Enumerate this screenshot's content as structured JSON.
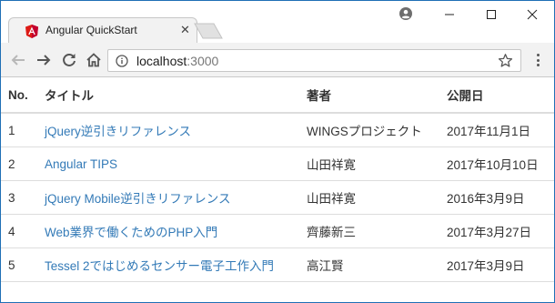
{
  "browser": {
    "tab_title": "Angular QuickStart",
    "tab_close_glyph": "✕",
    "url_host": "localhost",
    "url_port": ":3000",
    "icons": {
      "favicon": "angular-shield-icon",
      "profile": "profile-icon",
      "minimize": "minimize-icon",
      "maximize": "maximize-icon",
      "close": "close-icon",
      "back": "back-arrow-icon",
      "forward": "forward-arrow-icon",
      "reload": "reload-icon",
      "home": "home-icon",
      "info": "info-icon",
      "bookmark": "star-icon",
      "menu": "kebab-menu-icon"
    },
    "colors": {
      "accent_border": "#1f6fb5",
      "favicon_red": "#dd1b16",
      "link": "#337ab7"
    }
  },
  "table": {
    "headers": [
      "No.",
      "タイトル",
      "著者",
      "公開日"
    ],
    "rows": [
      {
        "no": "1",
        "title": "jQuery逆引きリファレンス",
        "author": "WINGSプロジェクト",
        "date": "2017年11月1日"
      },
      {
        "no": "2",
        "title": "Angular TIPS",
        "author": "山田祥寛",
        "date": "2017年10月10日"
      },
      {
        "no": "3",
        "title": "jQuery Mobile逆引きリファレンス",
        "author": "山田祥寛",
        "date": "2016年3月9日"
      },
      {
        "no": "4",
        "title": "Web業界で働くためのPHP入門",
        "author": "齊藤新三",
        "date": "2017年3月27日"
      },
      {
        "no": "5",
        "title": "Tessel 2ではじめるセンサー電子工作入門",
        "author": "高江賢",
        "date": "2017年3月9日"
      }
    ]
  }
}
